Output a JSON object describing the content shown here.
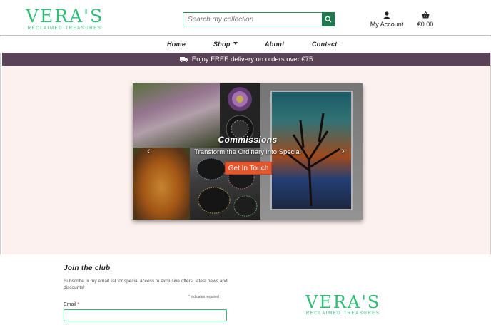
{
  "brand": {
    "name": "VERA'S",
    "tagline": "RECLAIMED TREASURES",
    "color": "#2ebd74"
  },
  "header": {
    "search_placeholder": "Search my collection",
    "account_label": "My Account",
    "bag_total": "€0.00"
  },
  "nav": {
    "items": [
      {
        "label": "Home"
      },
      {
        "label": "Shop"
      },
      {
        "label": "About"
      },
      {
        "label": "Contact"
      }
    ]
  },
  "banner": {
    "text": "Enjoy FREE delivery on orders over €75",
    "background": "#5b4357"
  },
  "carousel": {
    "title": "Commissions",
    "subtitle": "Transform the Ordinary into Special",
    "button_label": "Get In Touch",
    "button_color": "#e8552a",
    "prev_icon": "chevron-left-icon",
    "next_icon": "chevron-right-icon"
  },
  "club": {
    "title": "Join the club",
    "description": "Subscribe to my email list for special access to exclusive offers, latest news and discounts!",
    "required_note": "indicates required",
    "email_label": "Email",
    "email_value": ""
  }
}
